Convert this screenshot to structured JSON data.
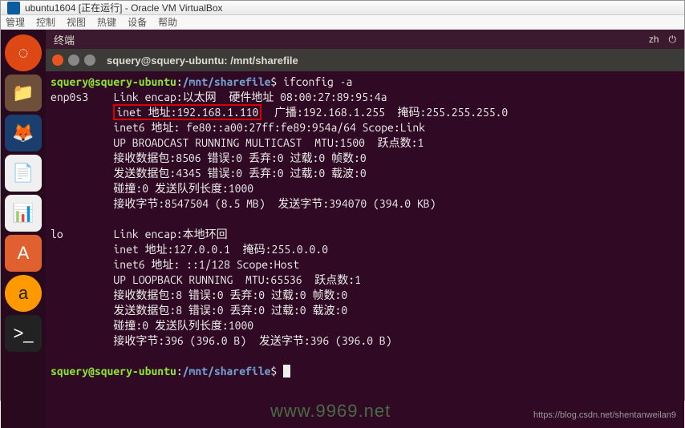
{
  "vbox": {
    "title": "ubuntu1604 [正在运行] - Oracle VM VirtualBox",
    "menu": [
      "管理",
      "控制",
      "视图",
      "热键",
      "设备",
      "帮助"
    ]
  },
  "panel": {
    "app_title": "终端",
    "indicators": [
      "zh",
      "⏻"
    ]
  },
  "launcher": {
    "items": [
      {
        "name": "ubuntu-dash",
        "glyph": "◌"
      },
      {
        "name": "files",
        "glyph": "📁"
      },
      {
        "name": "firefox",
        "glyph": "🦊"
      },
      {
        "name": "libreoffice-writer",
        "glyph": "📄"
      },
      {
        "name": "libreoffice-calc",
        "glyph": "📊"
      },
      {
        "name": "software-center",
        "glyph": "A"
      },
      {
        "name": "amazon",
        "glyph": "a"
      },
      {
        "name": "terminal",
        "glyph": ">_"
      }
    ]
  },
  "terminal": {
    "window_title": "squery@squery-ubuntu: /mnt/sharefile",
    "ps1": {
      "user_host": "squery@squery-ubuntu",
      "sep": ":",
      "path": "/mnt/sharefile",
      "prompt": "$"
    },
    "command": "ifconfig -a",
    "output": {
      "enp0s3": {
        "l1a": "enp0s3    Link encap:以太网  硬件地址 08:00:27:89:95:4a",
        "l2_hl": "inet 地址:192.168.1.110",
        "l2_rest": "  广播:192.168.1.255  掩码:255.255.255.0",
        "l3": "          inet6 地址: fe80::a00:27ff:fe89:954a/64 Scope:Link",
        "l4": "          UP BROADCAST RUNNING MULTICAST  MTU:1500  跃点数:1",
        "l5": "          接收数据包:8506 错误:0 丢弃:0 过载:0 帧数:0",
        "l6": "          发送数据包:4345 错误:0 丢弃:0 过载:0 载波:0",
        "l7": "          碰撞:0 发送队列长度:1000",
        "l8": "          接收字节:8547504 (8.5 MB)  发送字节:394070 (394.0 KB)"
      },
      "lo": {
        "l1": "lo        Link encap:本地环回",
        "l2": "          inet 地址:127.0.0.1  掩码:255.0.0.0",
        "l3": "          inet6 地址: ::1/128 Scope:Host",
        "l4": "          UP LOOPBACK RUNNING  MTU:65536  跃点数:1",
        "l5": "          接收数据包:8 错误:0 丢弃:0 过载:0 帧数:0",
        "l6": "          发送数据包:8 错误:0 丢弃:0 过载:0 载波:0",
        "l7": "          碰撞:0 发送队列长度:1000",
        "l8": "          接收字节:396 (396.0 B)  发送字节:396 (396.0 B)"
      }
    }
  },
  "watermark": "www.9969.net",
  "csdn": "https://blog.csdn.net/shentanweilan9"
}
